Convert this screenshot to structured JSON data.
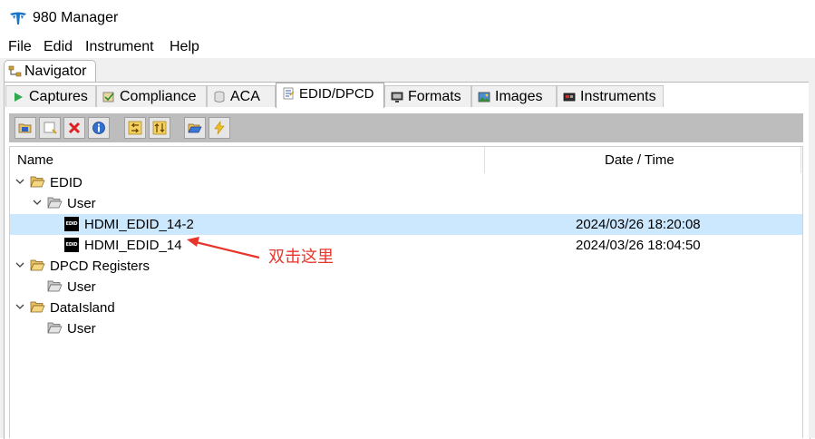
{
  "window": {
    "title": "980 Manager"
  },
  "menu": [
    "File",
    "Edid",
    "Instrument",
    "Help"
  ],
  "navigator": {
    "label": "Navigator"
  },
  "tabs": [
    {
      "label": "Captures",
      "icon": "play-icon"
    },
    {
      "label": "Compliance",
      "icon": "compliance-icon"
    },
    {
      "label": "ACA",
      "icon": "database-icon"
    },
    {
      "label": "EDID/DPCD",
      "icon": "edid-icon",
      "active": true
    },
    {
      "label": "Formats",
      "icon": "monitor-icon"
    },
    {
      "label": "Images",
      "icon": "image-icon"
    },
    {
      "label": "Instruments",
      "icon": "instrument-icon"
    }
  ],
  "toolbar": [
    "new-folder-icon",
    "new-file-icon",
    "delete-icon",
    "info-icon",
    "move-left-icon",
    "move-up-icon",
    "open-folder-icon",
    "lightning-icon"
  ],
  "tree": {
    "col_name": "Name",
    "col_date": "Date / Time",
    "rows": [
      {
        "label": "EDID",
        "type": "folder-open",
        "date": ""
      },
      {
        "label": "User",
        "type": "folder-open",
        "date": ""
      },
      {
        "label": "HDMI_EDID_14-2",
        "type": "edid",
        "date": "2024/03/26 18:20:08",
        "selected": true
      },
      {
        "label": "HDMI_EDID_14",
        "type": "edid",
        "date": "2024/03/26 18:04:50"
      },
      {
        "label": "DPCD Registers",
        "type": "folder-open",
        "date": ""
      },
      {
        "label": "User",
        "type": "folder",
        "date": ""
      },
      {
        "label": "DataIsland",
        "type": "folder-open",
        "date": ""
      },
      {
        "label": "User",
        "type": "folder",
        "date": ""
      }
    ]
  },
  "edid_icon_text": "EDID",
  "annotation": {
    "text": "双击这里",
    "color": "#e8352b"
  },
  "colors": {
    "selection": "#cce8ff",
    "toolbar": "#bdbdbd",
    "annotation": "#e8352b"
  }
}
